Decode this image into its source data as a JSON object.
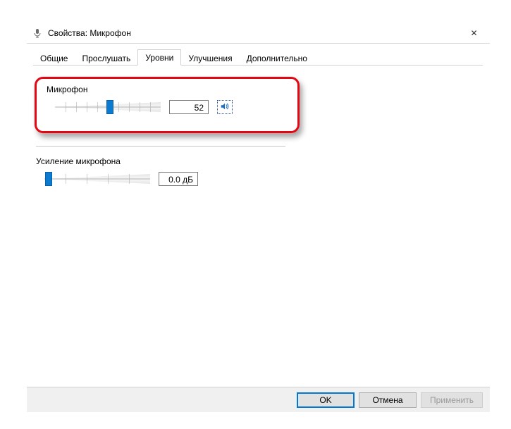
{
  "window": {
    "title": "Свойства: Микрофон"
  },
  "tabs": [
    {
      "label": "Общие"
    },
    {
      "label": "Прослушать"
    },
    {
      "label": "Уровни"
    },
    {
      "label": "Улучшения"
    },
    {
      "label": "Дополнительно"
    }
  ],
  "activeTabIndex": 2,
  "levels": {
    "microphone": {
      "label": "Микрофон",
      "value": "52",
      "percent": 52
    },
    "boost": {
      "label": "Усиление микрофона",
      "value": "0.0 дБ",
      "percent": 4
    }
  },
  "footer": {
    "ok": "OK",
    "cancel": "Отмена",
    "apply": "Применить"
  },
  "icons": {
    "close": "✕"
  }
}
